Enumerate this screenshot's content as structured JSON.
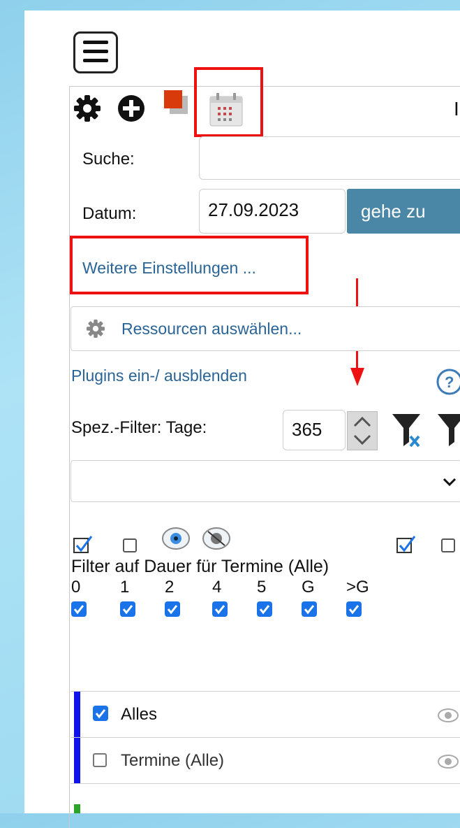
{
  "toolbar": {
    "menu_icon": "hamburger-menu-icon",
    "settings_icon": "gear-icon",
    "add_icon": "plus-circle-icon",
    "color_icon": "color-square-icon",
    "calendar_icon": "calendar-icon",
    "right_edge_glyph": "I"
  },
  "search": {
    "label": "Suche:",
    "value": ""
  },
  "date": {
    "label": "Datum:",
    "value": "27.09.2023",
    "goto_label": "gehe zu"
  },
  "more_settings": {
    "label": "Weitere Einstellungen ..."
  },
  "resources": {
    "label": "Ressourcen auswählen..."
  },
  "plugins": {
    "label": "Plugins ein-/ ausblenden",
    "help_icon": "help-circle-icon"
  },
  "special_filter": {
    "label": "Spez.-Filter: Tage:",
    "days_value": "365"
  },
  "dropdown": {
    "value": ""
  },
  "duration_filter": {
    "title": "Filter auf Dauer für Termine (Alle)",
    "columns": [
      "0",
      "1",
      "2",
      "4",
      "5",
      "G",
      ">G"
    ],
    "checked": [
      true,
      true,
      true,
      true,
      true,
      true,
      true
    ]
  },
  "list": {
    "items": [
      {
        "label": "Alles",
        "checked": true
      },
      {
        "label": "Termine (Alle)",
        "checked": false
      }
    ]
  },
  "colors": {
    "accent": "#4a86a6",
    "checkbox": "#1a73e8",
    "bar": "#1111ee",
    "highlight": "#e11111",
    "link": "#2a6496"
  }
}
